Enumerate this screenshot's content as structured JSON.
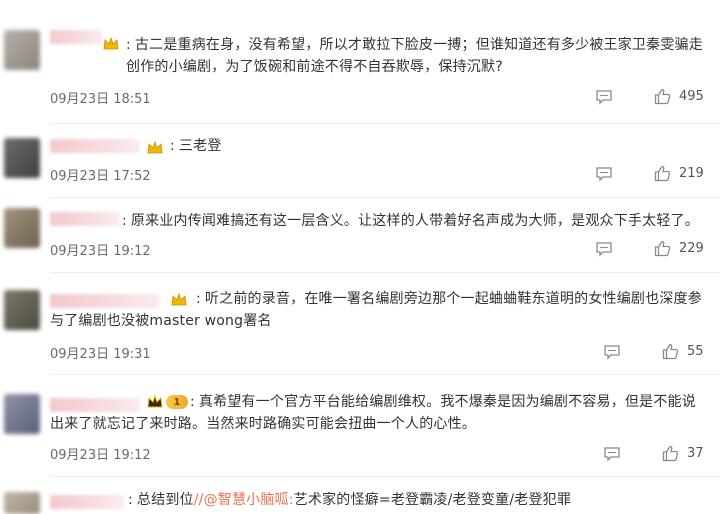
{
  "comments": [
    {
      "text": "古二是重病在身，没有希望，所以才敢拉下脸皮一搏；但谁知道还有多少被王家卫秦雯骗走创作的小编剧，为了饭碗和前途不得不自吞欺辱，保持沉默?",
      "time": "09月23日 18:51",
      "likes": "495"
    },
    {
      "text": "三老登",
      "time": "09月23日 17:52",
      "likes": "219"
    },
    {
      "text": "原来业内传闻难搞还有这一层含义。让这样的人带着好名声成为大师，是观众下手太轻了。",
      "time": "09月23日 19:12",
      "likes": "229"
    },
    {
      "text": "听之前的录音，在唯一署名编剧旁边那个一起蛐蛐鞋东道明的女性编剧也深度参与了编剧也没被master wong署名",
      "time": "09月23日 19:31",
      "likes": "55"
    },
    {
      "text": "真希望有一个官方平台能给编剧维权。我不爆秦是因为编剧不容易，但是不能说出来了就忘记了来时路。当然来时路确实可能会扭曲一个人的心性。",
      "time": "09月23日 19:12",
      "likes": "37",
      "vip_level": "1"
    },
    {
      "text_before": "总结到位",
      "mention": "//@智慧小脑呱:",
      "text_after": "艺术家的怪癖=老登霸凌/老登变童/老登犯罪"
    }
  ],
  "colors": {
    "mention": "#eb7350",
    "crown": "#f2b705",
    "icon": "#8a8a8a"
  },
  "icons": {
    "reply": "comment-icon",
    "like": "thumbs-up-icon",
    "badge": "crown-icon"
  }
}
